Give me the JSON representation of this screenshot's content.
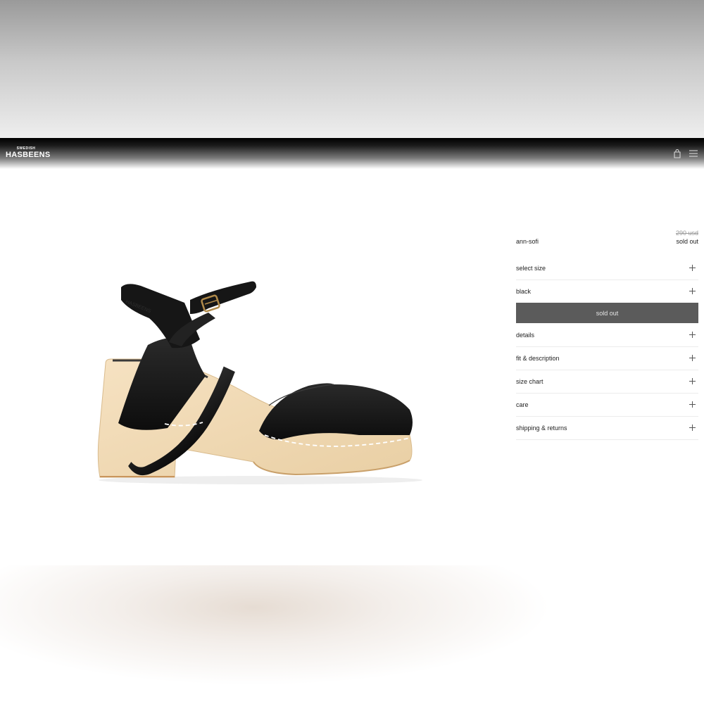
{
  "brand": {
    "logo_small": "SWEDISH",
    "logo_big": "HASBEENS"
  },
  "header": {
    "icons": [
      "bag-icon",
      "menu-icon"
    ]
  },
  "product": {
    "name": "ann-sofi",
    "price_original": "290 usd",
    "status": "sold out",
    "image": "black-leather-clog-sandal",
    "colors": {
      "leather": "#141414",
      "wood": "#f3dcb8",
      "stitching": "#ffffff",
      "buckle": "#b08a4a"
    }
  },
  "options": {
    "size_label": "select size",
    "color_label": "black"
  },
  "cta": {
    "label": "sold out",
    "color": "#5b5b5b"
  },
  "accordion": [
    {
      "label": "details"
    },
    {
      "label": "fit & description"
    },
    {
      "label": "size chart"
    },
    {
      "label": "care"
    },
    {
      "label": "shipping & returns"
    }
  ]
}
